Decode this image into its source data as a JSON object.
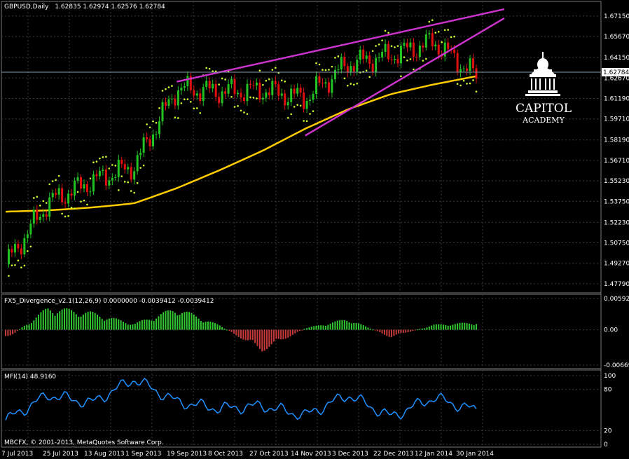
{
  "header": {
    "symbol_label": "GBPUSD,Daily",
    "ohlc": "1.62835 1.62974 1.62576 1.62784"
  },
  "logo": {
    "line1": "CAPITOL",
    "line2": "ACADEMY"
  },
  "footer": {
    "copyright": "MBCFX, © 2001-2013, MetaQuotes Software Corp."
  },
  "colors": {
    "background": "#000000",
    "grid": "#3a3a3a",
    "bull_candle": "#22c322",
    "bear_candle": "#e01010",
    "moving_average": "#ffcc00",
    "parabolic_sar": "#ccff33",
    "trendline": "#cc33cc",
    "histogram_positive": "#31c831",
    "histogram_negative": "#c83a3a",
    "mfi_line": "#1e90ff",
    "current_price_box": "#ffffff"
  },
  "chart_data": [
    {
      "type": "candlestick",
      "title": "GBPUSD,Daily",
      "ylim": [
        1.4733,
        1.676
      ],
      "yticks": [
        1.4779,
        1.4927,
        1.5075,
        1.5223,
        1.5375,
        1.5523,
        1.5671,
        1.5819,
        1.5971,
        1.6119,
        1.6267,
        1.6415,
        1.6567,
        1.6715
      ],
      "yticks_labels": [
        "1.47790",
        "1.49270",
        "1.50750",
        "1.52230",
        "1.53750",
        "1.55230",
        "1.56710",
        "1.58190",
        "1.59710",
        "1.61190",
        "1.62670",
        "1.64150",
        "1.65670",
        "1.67150"
      ],
      "current_price": "1.62784",
      "xticks": [
        "7 Jul 2013",
        "25 Jul 2013",
        "13 Aug 2013",
        "1 Sep 2013",
        "19 Sep 2013",
        "8 Oct 2013",
        "27 Oct 2013",
        "14 Nov 2013",
        "3 Dec 2013",
        "22 Dec 2013",
        "12 Jan 2014",
        "30 Jan 2014"
      ],
      "series": [
        {
          "name": "",
          "kind": "moving_average",
          "x": [
            "7 Jul 2013",
            "25 Jul 2013",
            "13 Aug 2013",
            "1 Sep 2013",
            "19 Sep 2013",
            "8 Oct 2013",
            "27 Oct 2013",
            "14 Nov 2013",
            "3 Dec 2013",
            "22 Dec 2013",
            "12 Jan 2014",
            "30 Jan 2014"
          ],
          "values": [
            1.53,
            1.531,
            1.533,
            1.536,
            1.547,
            1.56,
            1.574,
            1.59,
            1.604,
            1.615,
            1.622,
            1.628
          ]
        },
        {
          "name": "",
          "kind": "price_close",
          "x": [
            "7 Jul 2013",
            "25 Jul 2013",
            "13 Aug 2013",
            "1 Sep 2013",
            "19 Sep 2013",
            "8 Oct 2013",
            "27 Oct 2013",
            "14 Nov 2013",
            "3 Dec 2013",
            "22 Dec 2013",
            "12 Jan 2014",
            "30 Jan 2014"
          ],
          "values": [
            1.492,
            1.537,
            1.552,
            1.563,
            1.619,
            1.617,
            1.618,
            1.612,
            1.637,
            1.643,
            1.653,
            1.628
          ]
        }
      ],
      "trendlines": [
        {
          "from": [
            "19 Sep 2013",
            1.624
          ],
          "to": [
            "30 Jan 2014",
            1.672
          ]
        },
        {
          "from": [
            "14 Nov 2013",
            1.585
          ],
          "to": [
            "30 Jan 2014",
            1.658
          ]
        }
      ]
    },
    {
      "type": "bar",
      "title": "FX5_Divergence_v2.1(12,26,9) 0.0000000 -0.0039412 -0.0039412",
      "ylim": [
        -0.006692,
        0.00592
      ],
      "yticks_labels": [
        "0.005920",
        "0.00",
        "-0.006692"
      ],
      "x": [
        "7 Jul 2013",
        "25 Jul 2013",
        "13 Aug 2013",
        "1 Sep 2013",
        "19 Sep 2013",
        "8 Oct 2013",
        "27 Oct 2013",
        "14 Nov 2013",
        "3 Dec 2013",
        "22 Dec 2013",
        "12 Jan 2014",
        "30 Jan 2014"
      ],
      "values": [
        -0.002,
        0.0045,
        0.0035,
        0.0012,
        0.0044,
        0.0009,
        -0.0042,
        0.0003,
        0.0022,
        -0.0015,
        0.001,
        0.0015
      ]
    },
    {
      "type": "line",
      "title": "MFI(14) 48.9160",
      "ylim": [
        0,
        100
      ],
      "yticks_labels": [
        "100",
        "80",
        "20",
        "0"
      ],
      "x": [
        "7 Jul 2013",
        "25 Jul 2013",
        "13 Aug 2013",
        "1 Sep 2013",
        "19 Sep 2013",
        "8 Oct 2013",
        "27 Oct 2013",
        "14 Nov 2013",
        "3 Dec 2013",
        "22 Dec 2013",
        "12 Jan 2014",
        "30 Jan 2014"
      ],
      "values": [
        35,
        72,
        60,
        95,
        62,
        52,
        56,
        42,
        72,
        40,
        68,
        49
      ]
    }
  ]
}
